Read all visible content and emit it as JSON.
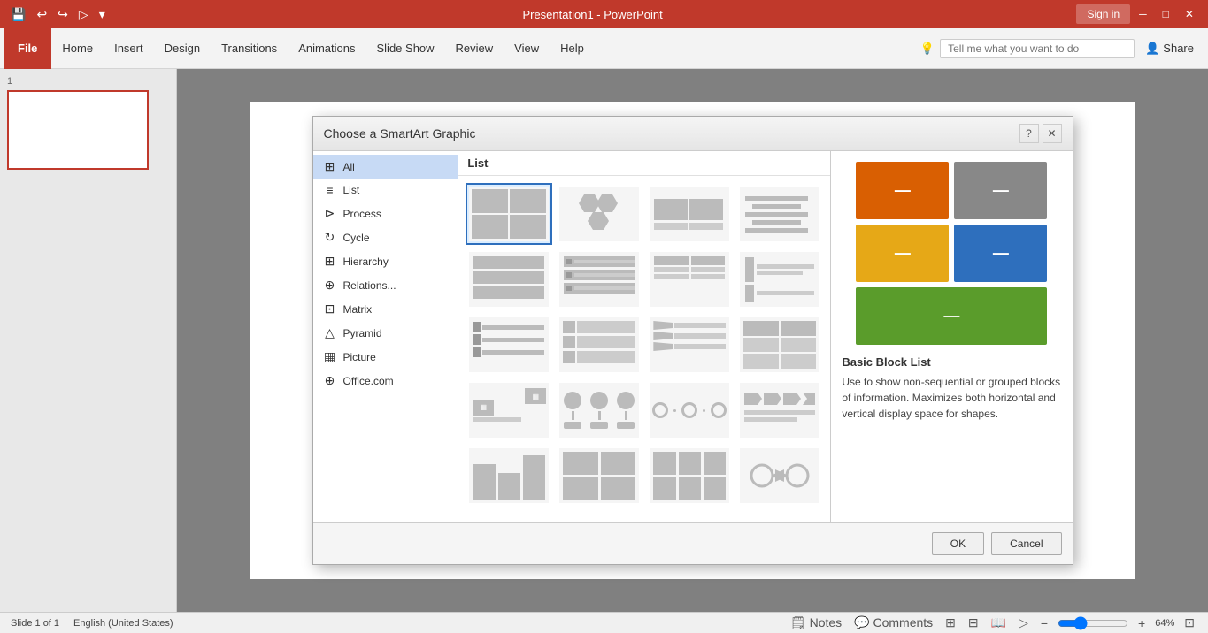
{
  "titlebar": {
    "title": "Presentation1 - PowerPoint",
    "sign_in": "Sign in",
    "minimize": "─",
    "restore": "□",
    "close": "✕"
  },
  "ribbon": {
    "tabs": [
      "File",
      "Home",
      "Insert",
      "Design",
      "Transitions",
      "Animations",
      "Slide Show",
      "Review",
      "View",
      "Help"
    ],
    "tell_me": "Tell me what you want to do",
    "share": "Share"
  },
  "slide_panel": {
    "slide_num": "1"
  },
  "dialog": {
    "title": "Choose a SmartArt Graphic",
    "section_label": "List",
    "categories": [
      {
        "label": "All",
        "icon": "☰"
      },
      {
        "label": "List",
        "icon": "≡"
      },
      {
        "label": "Process",
        "icon": "⊳"
      },
      {
        "label": "Cycle",
        "icon": "↻"
      },
      {
        "label": "Hierarchy",
        "icon": "⊞"
      },
      {
        "label": "Relations...",
        "icon": "⊕"
      },
      {
        "label": "Matrix",
        "icon": "⊡"
      },
      {
        "label": "Pyramid",
        "icon": "△"
      },
      {
        "label": "Picture",
        "icon": "▦"
      },
      {
        "label": "Office.com",
        "icon": "⊕"
      }
    ],
    "preview": {
      "name": "Basic Block List",
      "description": "Use to show non-sequential or grouped blocks of information. Maximizes both horizontal and vertical display space for shapes."
    },
    "ok_label": "OK",
    "cancel_label": "Cancel"
  },
  "statusbar": {
    "slide_info": "Slide 1 of 1",
    "language": "English (United States)",
    "notes": "Notes",
    "comments": "Comments",
    "zoom": "64%"
  },
  "preview_colors": {
    "orange": "#d95f02",
    "gray": "#888888",
    "yellow": "#e6a817",
    "blue": "#2e6fbd",
    "green": "#5a9c2b"
  }
}
